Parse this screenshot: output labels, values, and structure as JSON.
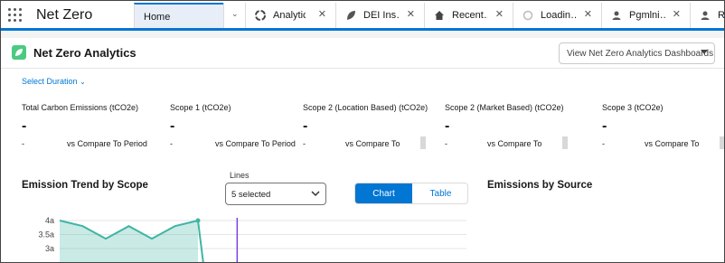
{
  "app": {
    "name": "Net Zero"
  },
  "tabs": [
    {
      "label": "Home",
      "icon": "",
      "active": true
    },
    {
      "label": "Analytic…",
      "icon": "analytics-icon"
    },
    {
      "label": "DEI Ins…",
      "icon": "leaf-icon"
    },
    {
      "label": "Recent…",
      "icon": "home-icon"
    },
    {
      "label": "Loadin…",
      "icon": "loading-icon"
    },
    {
      "label": "Pgmlni…",
      "icon": "people-icon"
    },
    {
      "label": "Rec",
      "icon": "people-icon"
    }
  ],
  "header": {
    "title": "Net Zero Analytics",
    "dashboards_button": "View Net Zero Analytics Dashboards"
  },
  "duration_link": "Select Duration",
  "kpis": [
    {
      "title": "Total Carbon Emissions (tCO2e)",
      "value": "-",
      "delta": "-",
      "compare": "vs Compare To Period"
    },
    {
      "title": "Scope 1 (tCO2e)",
      "value": "-",
      "delta": "-",
      "compare": "vs Compare To Period"
    },
    {
      "title": "Scope 2 (Location Based) (tCO2e)",
      "value": "-",
      "delta": "-",
      "compare": "vs Compare To"
    },
    {
      "title": "Scope 2 (Market Based) (tCO2e)",
      "value": "-",
      "delta": "-",
      "compare": "vs Compare To"
    },
    {
      "title": "Scope 3 (tCO2e)",
      "value": "-",
      "delta": "-",
      "compare": "vs Compare To"
    }
  ],
  "trend": {
    "title": "Emission Trend by Scope",
    "lines_label": "Lines",
    "lines_value": "5 selected",
    "toggle": {
      "chart": "Chart",
      "table": "Table"
    }
  },
  "sources": {
    "title": "Emissions by Source"
  },
  "colors": {
    "brand": "#0176d3",
    "series": "#3fb5a4",
    "marker": "#7b3fe4"
  },
  "chart_data": {
    "type": "area",
    "x": [
      1,
      2,
      3,
      4,
      5,
      6,
      7
    ],
    "values": [
      4.0,
      3.8,
      3.35,
      3.8,
      3.35,
      3.8,
      4.0
    ],
    "ytick_labels": [
      "4a",
      "3.5a",
      "3a"
    ],
    "ytick_values": [
      4.0,
      3.5,
      3.0
    ],
    "ylim": [
      2.8,
      4.2
    ],
    "marker_x": 8.7
  }
}
